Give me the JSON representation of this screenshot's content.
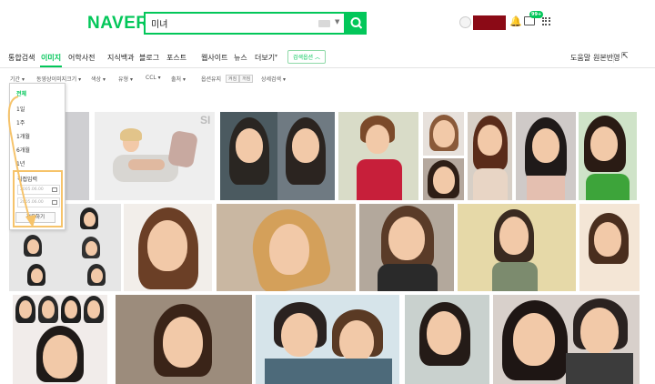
{
  "header": {
    "logo": "NAVER",
    "search_query": "미녀"
  },
  "nav": {
    "items": [
      "통합검색",
      "이미지",
      "어학사전",
      "지식백과",
      "블로그",
      "포스트",
      "웹사이트",
      "뉴스",
      "더보기"
    ],
    "search_option": "검색옵션",
    "right": [
      "도움말",
      "원본반영"
    ]
  },
  "filters": [
    "기간",
    "동영상이미지크기",
    "색상",
    "유형",
    "CCL",
    "출처",
    "옵션유지"
  ],
  "filter_tags": [
    "켜짐",
    "꺼짐"
  ],
  "filter_detail": "상세검색",
  "period_dropdown": {
    "options": [
      "전체",
      "1일",
      "1주",
      "1개월",
      "6개월",
      "1년"
    ],
    "custom_label": "직접입력",
    "date_from": "2005.06.00",
    "date_to": "2005.06.00",
    "apply": "적용하기"
  },
  "images": {
    "tile_watermark": "SI"
  },
  "colors": {
    "brand": "#03c75a",
    "highlight": "#f6c36a",
    "user_box": "#8b0a16"
  },
  "icons": [
    "search-icon",
    "profile-icon",
    "bell-icon",
    "mail-icon",
    "apps-icon",
    "share-icon",
    "calendar-icon"
  ]
}
